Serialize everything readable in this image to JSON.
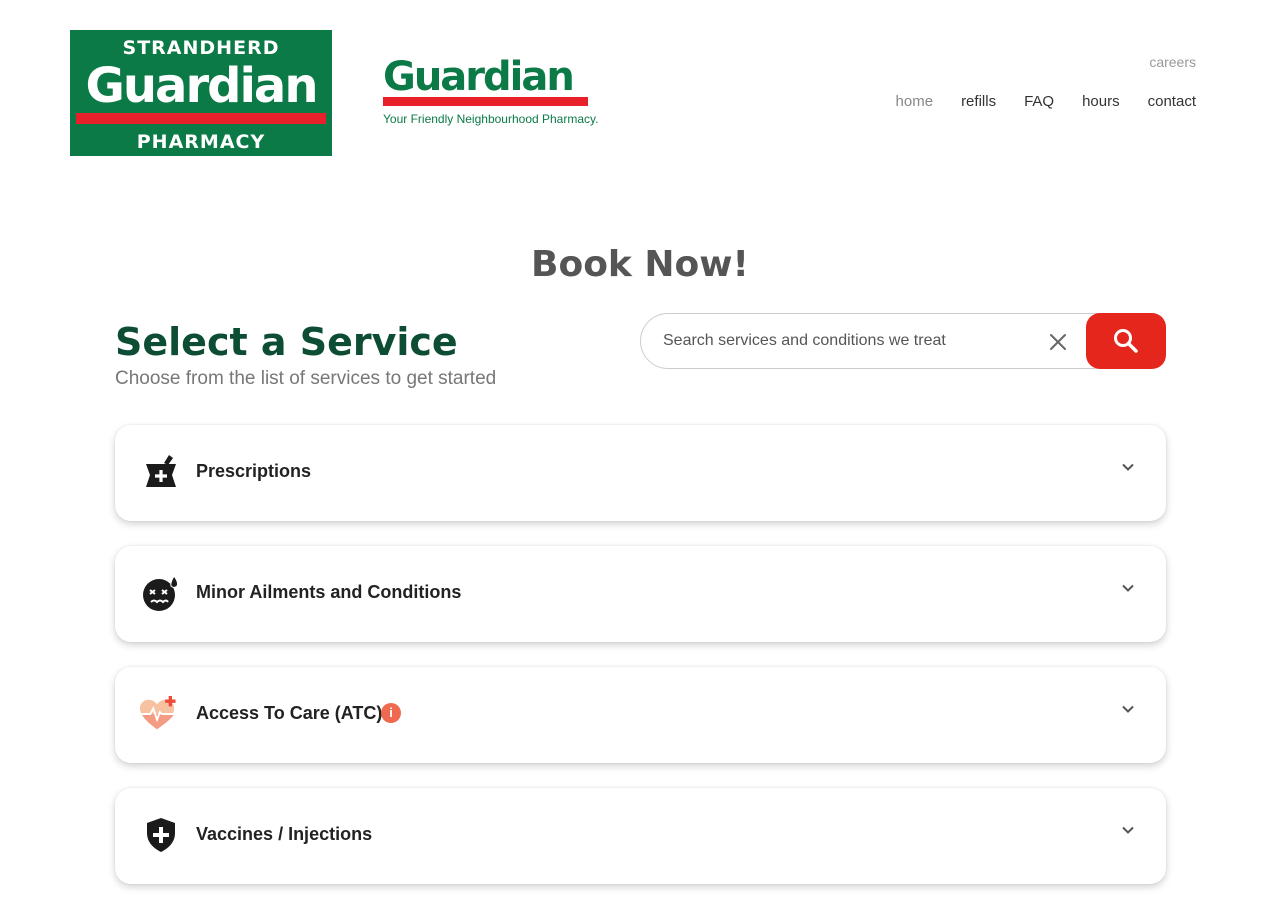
{
  "header": {
    "logo_main": {
      "top": "STRANDHERD",
      "middle": "Guardian",
      "bottom": "PHARMACY"
    },
    "logo_secondary": {
      "word": "Guardian",
      "tagline": "Your Friendly Neighbourhood Pharmacy."
    },
    "careers_label": "careers",
    "nav": [
      "home",
      "refills",
      "FAQ",
      "hours",
      "contact"
    ],
    "active_nav": "home"
  },
  "main": {
    "book_title": "Book Now!",
    "select_title": "Select a Service",
    "select_subtitle": "Choose from the list of services to get started",
    "search": {
      "placeholder": "Search services and conditions we treat",
      "value": ""
    },
    "services": [
      {
        "label": "Prescriptions",
        "icon": "mortar-pestle-icon"
      },
      {
        "label": "Minor Ailments and Conditions",
        "icon": "sick-face-icon"
      },
      {
        "label": "Access To Care (ATC)",
        "icon": "heart-plus-icon",
        "info_badge": "i"
      },
      {
        "label": "Vaccines / Injections",
        "icon": "shield-plus-icon"
      }
    ]
  },
  "colors": {
    "brand_green": "#0b7a47",
    "brand_red": "#e8202a",
    "title_green": "#0d4d34",
    "search_button": "#e4261c",
    "info_badge": "#ee6950"
  }
}
